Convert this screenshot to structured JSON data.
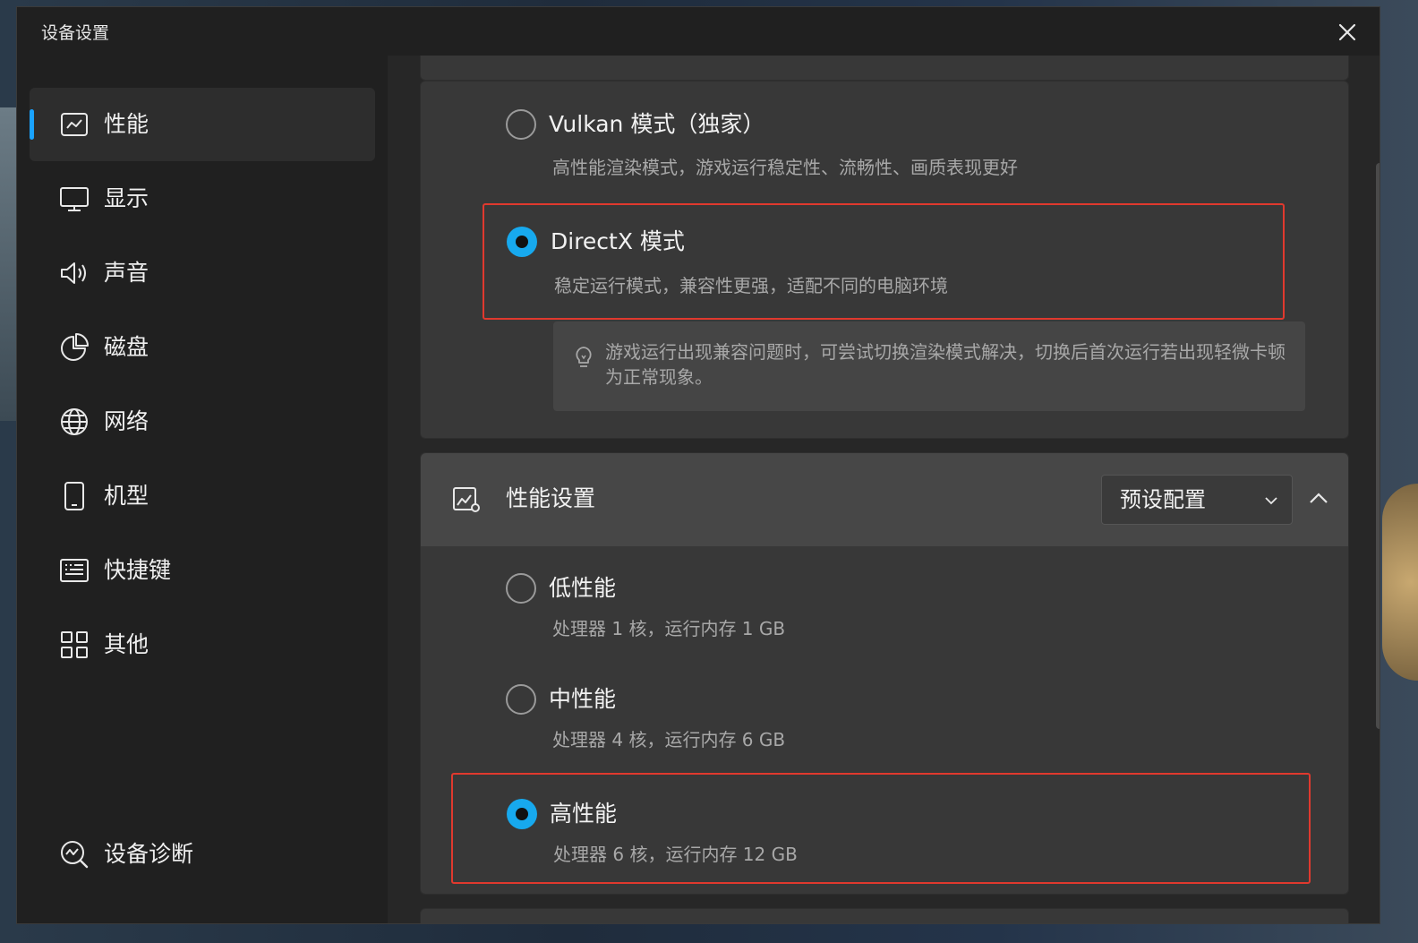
{
  "window": {
    "title": "设备设置"
  },
  "sidebar": {
    "items": [
      {
        "label": "性能",
        "icon": "performance-chart-icon",
        "active": true
      },
      {
        "label": "显示",
        "icon": "monitor-icon"
      },
      {
        "label": "声音",
        "icon": "speaker-icon"
      },
      {
        "label": "磁盘",
        "icon": "pie-chart-icon"
      },
      {
        "label": "网络",
        "icon": "globe-icon"
      },
      {
        "label": "机型",
        "icon": "phone-icon"
      },
      {
        "label": "快捷键",
        "icon": "keyboard-icon"
      },
      {
        "label": "其他",
        "icon": "grid-icon"
      }
    ],
    "diagnostics": {
      "label": "设备诊断",
      "icon": "diagnostics-icon"
    }
  },
  "render_mode": {
    "options": [
      {
        "title": "Vulkan 模式（独家）",
        "desc": "高性能渲染模式，游戏运行稳定性、流畅性、画质表现更好",
        "checked": false
      },
      {
        "title": "DirectX 模式",
        "desc": "稳定运行模式，兼容性更强，适配不同的电脑环境",
        "checked": true
      }
    ],
    "tip": "游戏运行出现兼容问题时，可尝试切换渲染模式解决，切换后首次运行若出现轻微卡顿为正常现象。"
  },
  "performance": {
    "title": "性能设置",
    "select_value": "预设配置",
    "options": [
      {
        "title": "低性能",
        "desc": "处理器 1 核，运行内存 1 GB",
        "checked": false
      },
      {
        "title": "中性能",
        "desc": "处理器 4 核，运行内存 6 GB",
        "checked": false
      },
      {
        "title": "高性能",
        "desc": "处理器 6 核，运行内存 12 GB",
        "checked": true
      }
    ]
  },
  "colors": {
    "accent": "#17a9ee",
    "highlight": "#e0392e"
  }
}
